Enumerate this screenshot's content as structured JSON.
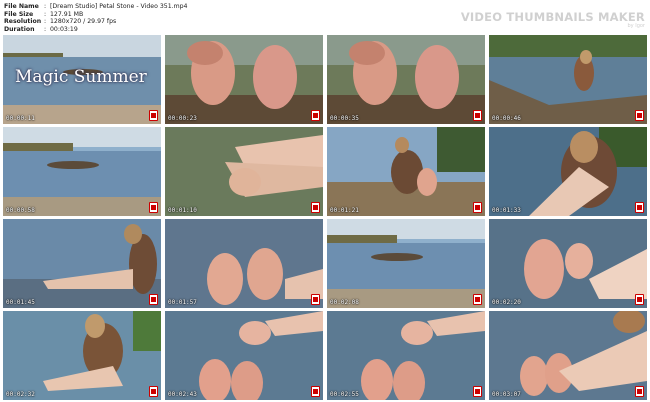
{
  "info": {
    "rows": [
      {
        "key": "File Name",
        "sep": ":",
        "value": "[Dream Studio] Petal Stone - Video 351.mp4"
      },
      {
        "key": "File Size",
        "sep": ":",
        "value": "127.91 MB"
      },
      {
        "key": "Resolution",
        "sep": ":",
        "value": "1280x720 / 29.97 fps"
      },
      {
        "key": "Duration",
        "sep": ":",
        "value": "00:03:19"
      }
    ]
  },
  "brand": {
    "main": "VIDEO THUMBNAILS MAKER",
    "sub": "by Igor"
  },
  "overlay_title": "Magic Summer",
  "thumbnails": [
    {
      "time": "00:00:11",
      "scene": "lake-boat-title"
    },
    {
      "time": "00:00:23",
      "scene": "soles-close"
    },
    {
      "time": "00:00:35",
      "scene": "soles-close"
    },
    {
      "time": "00:00:46",
      "scene": "girl-shore"
    },
    {
      "time": "00:00:58",
      "scene": "lake-boat"
    },
    {
      "time": "00:01:10",
      "scene": "legs-water"
    },
    {
      "time": "00:01:21",
      "scene": "girl-sitting"
    },
    {
      "time": "00:01:33",
      "scene": "girl-closeup"
    },
    {
      "time": "00:01:45",
      "scene": "girl-water-sit"
    },
    {
      "time": "00:01:57",
      "scene": "feet-water"
    },
    {
      "time": "00:02:08",
      "scene": "lake-boat"
    },
    {
      "time": "00:02:20",
      "scene": "feet-hand"
    },
    {
      "time": "00:02:32",
      "scene": "girl-water-sit2"
    },
    {
      "time": "00:02:43",
      "scene": "hands-feet"
    },
    {
      "time": "00:02:55",
      "scene": "hands-feet"
    },
    {
      "time": "00:03:07",
      "scene": "feet-legs"
    }
  ]
}
